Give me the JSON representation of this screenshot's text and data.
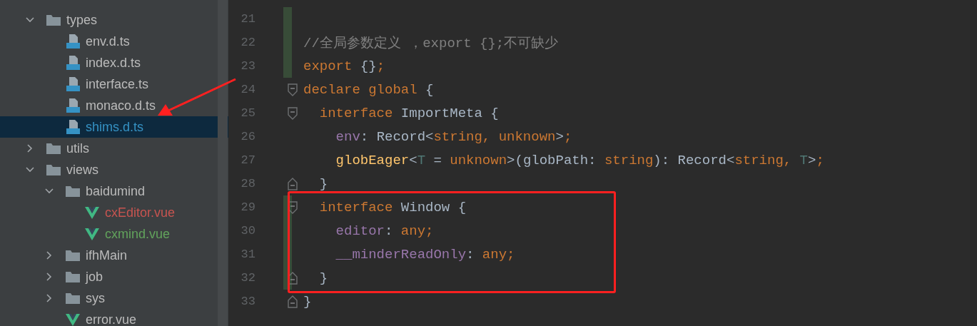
{
  "project_tree": [
    {
      "name": "types",
      "kind": "folder",
      "expanded": true,
      "selected": false,
      "children": [
        {
          "name": "env.d.ts",
          "kind": "ts",
          "selected": false
        },
        {
          "name": "index.d.ts",
          "kind": "ts",
          "selected": false
        },
        {
          "name": "interface.ts",
          "kind": "ts",
          "selected": false
        },
        {
          "name": "monaco.d.ts",
          "kind": "ts",
          "selected": false
        },
        {
          "name": "shims.d.ts",
          "kind": "ts",
          "selected": true
        }
      ]
    },
    {
      "name": "utils",
      "kind": "folder",
      "expanded": false,
      "selected": false
    },
    {
      "name": "views",
      "kind": "folder",
      "expanded": true,
      "selected": false,
      "children": [
        {
          "name": "baidumind",
          "kind": "folder",
          "expanded": true,
          "selected": false,
          "children": [
            {
              "name": "cxEditor.vue",
              "kind": "vue",
              "selected": false,
              "color": "#c75450"
            },
            {
              "name": "cxmind.vue",
              "kind": "vue",
              "selected": false,
              "color": "#62a35c"
            }
          ]
        },
        {
          "name": "ifhMain",
          "kind": "folder",
          "expanded": false,
          "selected": false
        },
        {
          "name": "job",
          "kind": "folder",
          "expanded": false,
          "selected": false
        },
        {
          "name": "sys",
          "kind": "folder",
          "expanded": false,
          "selected": false
        },
        {
          "name": "error.vue",
          "kind": "vue",
          "selected": false
        }
      ]
    }
  ],
  "editor": {
    "lines": [
      {
        "number": "21",
        "changed": true,
        "fold_start": false,
        "fold_end": false
      },
      {
        "number": "22",
        "changed": true,
        "fold_start": false,
        "fold_end": false,
        "tokens": [
          {
            "kind": "comment",
            "text": "//全局参数定义 ，export {};不可缺少"
          }
        ]
      },
      {
        "number": "23",
        "changed": true,
        "fold_start": false,
        "fold_end": false,
        "tokens": [
          {
            "kind": "keyword",
            "text": "export "
          },
          {
            "kind": "plain",
            "text": "{}"
          },
          {
            "kind": "keyword",
            "text": ";"
          }
        ]
      },
      {
        "number": "24",
        "changed": false,
        "fold_start": true,
        "fold_end": false,
        "tokens": [
          {
            "kind": "keyword",
            "text": "declare global "
          },
          {
            "kind": "plain",
            "text": "{"
          }
        ]
      },
      {
        "number": "25",
        "changed": false,
        "fold_start": true,
        "fold_end": false,
        "tokens": [
          {
            "kind": "keyword",
            "text": "  interface "
          },
          {
            "kind": "plain",
            "text": "ImportMeta {"
          }
        ]
      },
      {
        "number": "26",
        "changed": false,
        "fold_start": false,
        "fold_end": false,
        "tokens": [
          {
            "kind": "field",
            "text": "    env"
          },
          {
            "kind": "plain",
            "text": ": Record<"
          },
          {
            "kind": "keyword",
            "text": "string, unknown"
          },
          {
            "kind": "plain",
            "text": ">"
          },
          {
            "kind": "keyword",
            "text": ";"
          }
        ]
      },
      {
        "number": "27",
        "changed": false,
        "fold_start": false,
        "fold_end": false,
        "tokens": [
          {
            "kind": "function",
            "text": "    globEager"
          },
          {
            "kind": "plain",
            "text": "<"
          },
          {
            "kind": "typeparam",
            "text": "T"
          },
          {
            "kind": "plain",
            "text": " = "
          },
          {
            "kind": "keyword",
            "text": "unknown"
          },
          {
            "kind": "plain",
            "text": ">(globPath: "
          },
          {
            "kind": "keyword",
            "text": "string"
          },
          {
            "kind": "plain",
            "text": "): Record<"
          },
          {
            "kind": "keyword",
            "text": "string, "
          },
          {
            "kind": "typeparam",
            "text": "T"
          },
          {
            "kind": "plain",
            "text": ">"
          },
          {
            "kind": "keyword",
            "text": ";"
          }
        ]
      },
      {
        "number": "28",
        "changed": false,
        "fold_start": false,
        "fold_end": true,
        "tokens": [
          {
            "kind": "plain",
            "text": "  }"
          }
        ]
      },
      {
        "number": "29",
        "changed": true,
        "fold_start": true,
        "fold_end": false,
        "tokens": [
          {
            "kind": "keyword",
            "text": "  interface "
          },
          {
            "kind": "plain",
            "text": "Window {"
          }
        ]
      },
      {
        "number": "30",
        "changed": true,
        "fold_start": false,
        "fold_end": false,
        "tokens": [
          {
            "kind": "field",
            "text": "    editor"
          },
          {
            "kind": "plain",
            "text": ": "
          },
          {
            "kind": "keyword",
            "text": "any;"
          }
        ]
      },
      {
        "number": "31",
        "changed": true,
        "fold_start": false,
        "fold_end": false,
        "tokens": [
          {
            "kind": "field",
            "text": "    __minderReadOnly"
          },
          {
            "kind": "plain",
            "text": ": "
          },
          {
            "kind": "keyword",
            "text": "any;"
          }
        ]
      },
      {
        "number": "32",
        "changed": true,
        "fold_start": false,
        "fold_end": true,
        "tokens": [
          {
            "kind": "plain",
            "text": "  }"
          }
        ]
      },
      {
        "number": "33",
        "changed": false,
        "fold_start": false,
        "fold_end": true,
        "tokens": [
          {
            "kind": "plain",
            "text": "}"
          }
        ]
      }
    ]
  }
}
